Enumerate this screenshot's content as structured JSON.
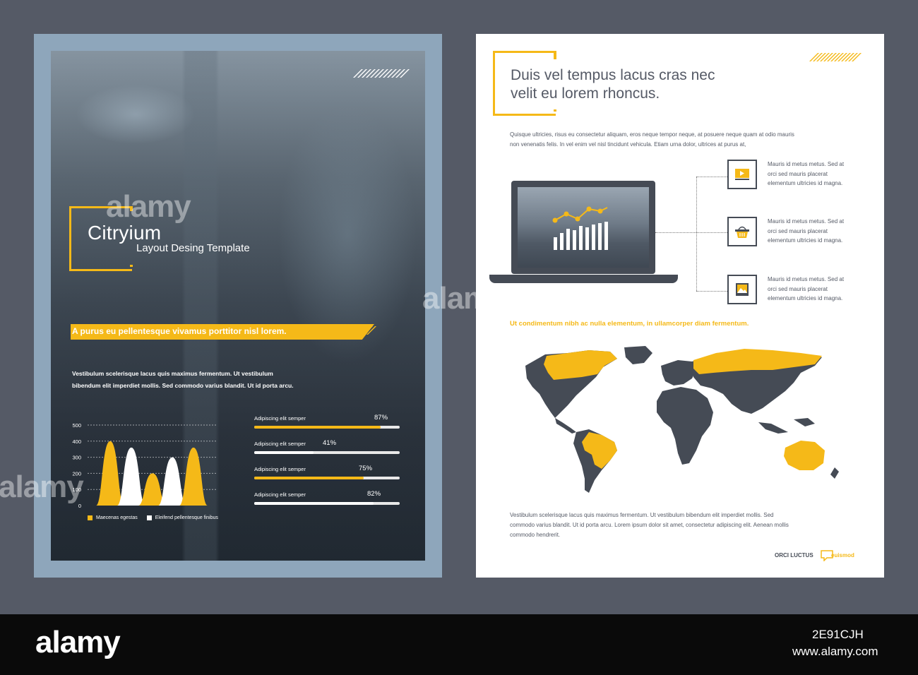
{
  "left_page": {
    "brand_title": "Citryium",
    "brand_subtitle": "Layout Desing Template",
    "banner_text": "A purus eu pellentesque vivamus porttitor nisl lorem.",
    "paragraph_line1": "Vestibulum scelerisque lacus quis maximus fermentum. Ut vestibulum",
    "paragraph_line2": "bibendum elit imperdiet mollis. Sed commodo varius blandit. Ut id porta arcu."
  },
  "chart_data": [
    {
      "type": "area",
      "y_ticks": [
        "500",
        "400",
        "300",
        "200",
        "100",
        "0"
      ],
      "ylim": [
        0,
        500
      ],
      "grid": true,
      "legend_position": "bottom",
      "series": [
        {
          "name": "Maecenas egestas",
          "color": "#f5b918",
          "peaks": [
            400,
            200,
            360
          ]
        },
        {
          "name": "Eleifend pellentesque finibus",
          "color": "#ffffff",
          "peaks": [
            360,
            300
          ]
        }
      ]
    },
    {
      "type": "bar",
      "orientation": "horizontal",
      "categories": [
        "Adipiscing elit semper",
        "Adipiscing elit semper",
        "Adipiscing elit semper",
        "Adipiscing elit semper"
      ],
      "values": [
        87,
        41,
        75,
        82
      ],
      "value_labels": [
        "87%",
        "41%",
        "75%",
        "82%"
      ],
      "colors": [
        "#f5b918",
        "#ffffff",
        "#f5b918",
        "#ffffff"
      ],
      "xlim": [
        0,
        100
      ]
    }
  ],
  "right_page": {
    "heading_line1": "Duis vel tempus lacus cras nec",
    "heading_line2": "velit eu lorem rhoncus.",
    "intro_line1": "Quisque ultricies, risus eu consectetur aliquam, eros neque tempor neque, at posuere neque quam at odio mauris",
    "intro_line2": "non venenatis felis. In vel enim vel nisl tincidunt vehicula. Etiam urna dolor, ultrices at purus at,",
    "features": [
      {
        "icon": "video-icon",
        "line1": "Mauris id metus metus. Sed at",
        "line2": "orci sed mauris placerat",
        "line3": "elementum ultricies id magna."
      },
      {
        "icon": "basket-icon",
        "line1": "Mauris id metus metus. Sed at",
        "line2": "orci sed mauris placerat",
        "line3": "elementum ultricies id magna."
      },
      {
        "icon": "image-icon",
        "line1": "Mauris id metus metus. Sed at",
        "line2": "orci sed mauris placerat",
        "line3": "elementum ultricies id magna."
      }
    ],
    "map_heading": "Ut condimentum nibh ac nulla elementum, in ullamcorper diam fermentum.",
    "map_highlighted_regions": [
      "Canada",
      "Russia",
      "Brazil",
      "Australia"
    ],
    "body_line1": "Vestibulum scelerisque lacus quis maximus fermentum. Ut vestibulum bibendum elit imperdiet mollis. Sed",
    "body_line2": "commodo varius blandit. Ut id porta arcu. Lorem ipsum dolor sit amet, consectetur adipiscing elit. Aenean mollis",
    "body_line3": "commodo hendrerit.",
    "footer_left": "ORCI LUCTUS",
    "footer_right": "euismod"
  },
  "colors": {
    "accent": "#f5b918",
    "dark": "#454b55",
    "background": "#555a66"
  },
  "watermark": {
    "text": "alamy",
    "image_id": "2E91CJH",
    "url": "www.alamy.com"
  }
}
